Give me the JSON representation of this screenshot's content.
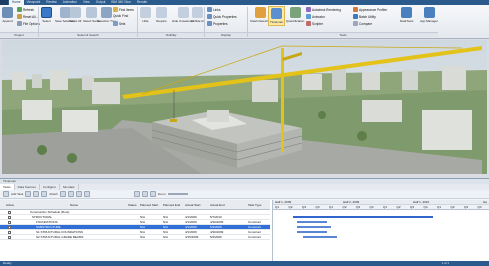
{
  "ribbon": {
    "tabs": [
      "Home",
      "Viewpoint",
      "Review",
      "Animation",
      "View",
      "Output",
      "BIM 360 Glue",
      "Render"
    ],
    "active_tab": "Home",
    "buttons": {
      "append": "Append",
      "refresh": "Refresh",
      "reset_all": "Reset All...",
      "file_options": "File Options",
      "select": "Select",
      "save_selection": "Save Selection",
      "select_all": "Select All",
      "select_same": "Select Same",
      "selection_tree": "Selection Tree",
      "find_items": "Find Items",
      "quick_find": "Quick Find",
      "sets": "Sets",
      "hide": "Hide",
      "require": "Require",
      "hide_unselected": "Hide Unselected",
      "unhide_all": "Unhide All",
      "links": "Links",
      "quick_properties": "Quick Properties",
      "properties": "Properties",
      "clash_detective": "Clash Detective",
      "timeliner": "TimeLiner",
      "quantification": "Quantification",
      "autodesk_rendering": "Autodesk Rendering",
      "animator": "Animator",
      "scripter": "Scripter",
      "appearance_profiler": "Appearance Profiler",
      "batch_utility": "Batch Utility",
      "compare": "Compare",
      "datatools": "DataTools",
      "app_manager": "App Manager"
    },
    "groups": [
      "Project",
      "Select & Search",
      "Visibility",
      "Display",
      "Tools"
    ]
  },
  "panel": {
    "title": "TimeLiner",
    "tabs": [
      "Tasks",
      "Data Sources",
      "Configure",
      "Simulate"
    ],
    "active_tab": "Tasks",
    "toolbar": {
      "add_task": "Add Task",
      "attach": "Attach",
      "zoom_label": "Zoom:"
    },
    "columns": [
      "Active",
      "Name",
      "Status",
      "Planned Start",
      "Planned End",
      "Actual Start",
      "Actual End",
      "Task Type"
    ],
    "rows": [
      {
        "name": "Construction Schedule (Root)",
        "status": "",
        "planned_start": "",
        "planned_end": "",
        "actual_start": "",
        "actual_end": "",
        "type": "",
        "selected": false
      },
      {
        "name": "STRUCTURAL",
        "status": "",
        "planned_start": "N/A",
        "planned_end": "N/A",
        "actual_start": "4/1/2009",
        "actual_end": "5/7/2010",
        "type": "",
        "selected": false
      },
      {
        "name": "FOUNDATIONS",
        "status": "",
        "planned_start": "N/A",
        "planned_end": "N/A",
        "actual_start": "4/1/2009",
        "actual_end": "4/30/2009",
        "type": "Construct",
        "selected": false
      },
      {
        "name": "SUBSTRUCTURE",
        "status": "",
        "planned_start": "N/A",
        "planned_end": "N/A",
        "actual_start": "4/1/2009",
        "actual_end": "5/4/2009",
        "type": "Construct",
        "selected": true
      },
      {
        "name": "S1 STRUCTURAL FOUNDATIONS",
        "status": "",
        "planned_start": "N/A",
        "planned_end": "N/A",
        "actual_start": "4/1/2009",
        "actual_end": "4/30/2009",
        "type": "Construct",
        "selected": false
      },
      {
        "name": "S2 STRUCTURAL GRADE BEAMS",
        "status": "",
        "planned_start": "N/A",
        "planned_end": "N/A",
        "actual_start": "4/15/2009",
        "actual_end": "5/4/2009",
        "type": "Construct",
        "selected": false
      }
    ],
    "gantt": {
      "months": [
        "Half 1, 2009",
        "Half 2, 2009",
        "Half 1, 2010",
        "Ha"
      ],
      "quarters": [
        "Q1",
        "Q2",
        "Q3",
        "Q4",
        "Q1",
        "Q2",
        "Q3",
        "Q4",
        "Q1",
        "Q2",
        "Q3",
        "Q4",
        "Q1",
        "Q2",
        "Q3",
        "Q4"
      ]
    }
  },
  "status_bar": {
    "left": "Ready",
    "right": "1 of 1"
  },
  "colors": {
    "accent": "#2b5b8c",
    "selection": "#2f6fd6",
    "gantt_bar": "#3366cc"
  }
}
